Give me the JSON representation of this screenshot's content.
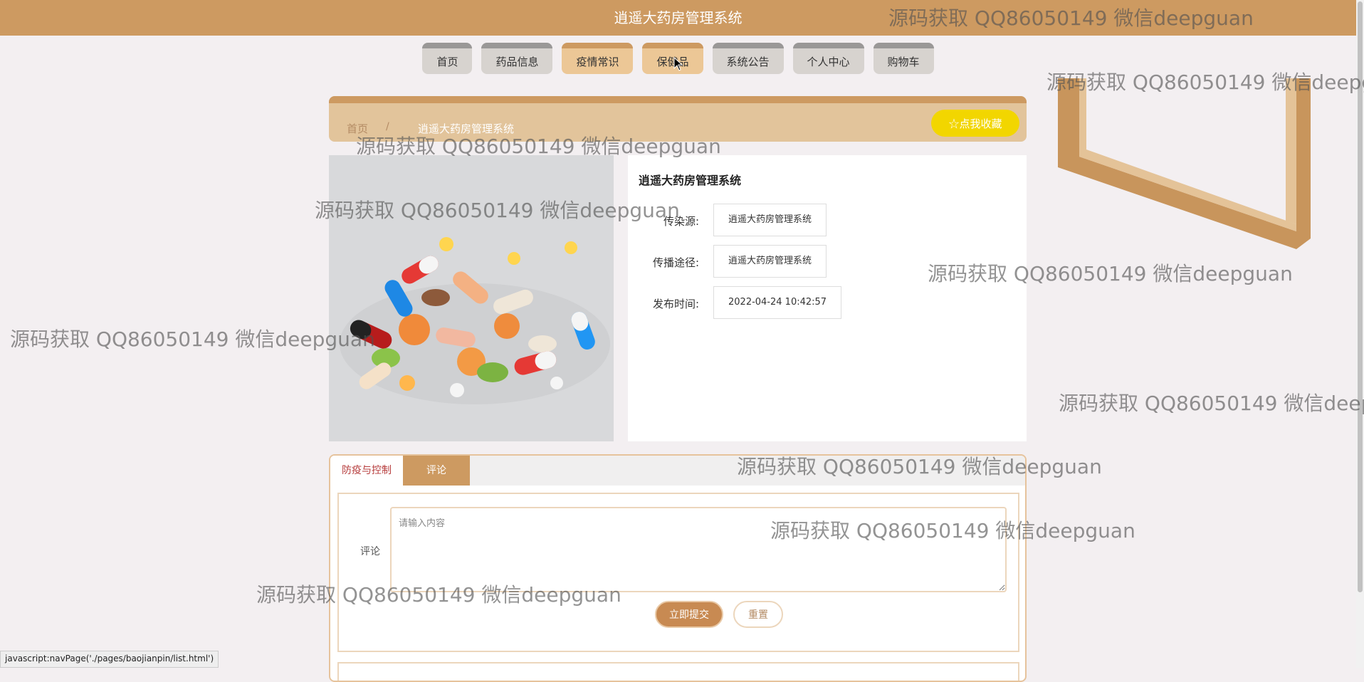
{
  "app": {
    "title": "逍遥大药房管理系统"
  },
  "nav": {
    "items": [
      {
        "label": "首页"
      },
      {
        "label": "药品信息"
      },
      {
        "label": "疫情常识"
      },
      {
        "label": "保健品"
      },
      {
        "label": "系统公告"
      },
      {
        "label": "个人中心"
      },
      {
        "label": "购物车"
      }
    ]
  },
  "breadcrumb": {
    "home": "首页",
    "separator": "/",
    "current": "逍遥大药房管理系统",
    "collect_label": "☆点我收藏"
  },
  "detail": {
    "title": "逍遥大药房管理系统",
    "fields": [
      {
        "label": "传染源:",
        "value": "逍遥大药房管理系统"
      },
      {
        "label": "传播途径:",
        "value": "逍遥大药房管理系统"
      },
      {
        "label": "发布时间:",
        "value": "2022-04-24 10:42:57"
      }
    ]
  },
  "tabs": [
    {
      "label": "防疫与控制"
    },
    {
      "label": "评论"
    }
  ],
  "comment_form": {
    "label": "评论",
    "placeholder": "请输入内容",
    "submit_label": "立即提交",
    "reset_label": "重置"
  },
  "status_bar": {
    "link": "javascript:navPage('./pages/baojianpin/list.html')"
  },
  "watermark": {
    "text": "源码获取 QQ86050149 微信deepguan"
  },
  "colors": {
    "accent": "#cd9a61",
    "collect_button": "#f2d600",
    "nav_active": "#ecc796",
    "tab_active_text": "#b63b3b"
  }
}
